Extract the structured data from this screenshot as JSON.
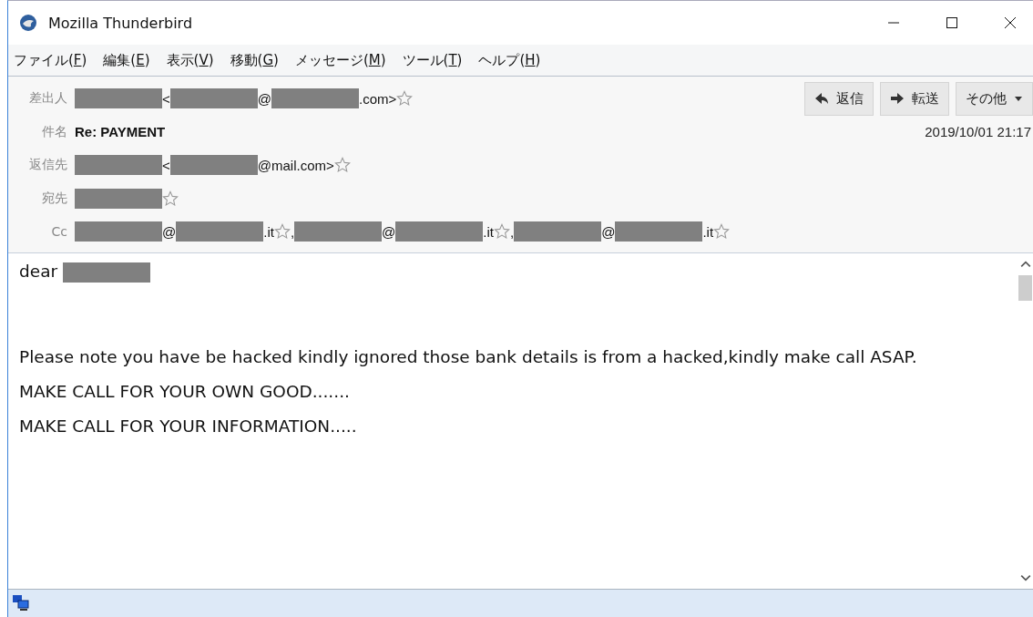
{
  "window": {
    "title": "Mozilla Thunderbird"
  },
  "menu": [
    {
      "label": "ファイル(",
      "accel": "F",
      "suffix": ")"
    },
    {
      "label": "編集(",
      "accel": "E",
      "suffix": ")"
    },
    {
      "label": "表示(",
      "accel": "V",
      "suffix": ")"
    },
    {
      "label": "移動(",
      "accel": "G",
      "suffix": ")"
    },
    {
      "label": "メッセージ(",
      "accel": "M",
      "suffix": ")"
    },
    {
      "label": "ツール(",
      "accel": "T",
      "suffix": ")"
    },
    {
      "label": "ヘルプ(",
      "accel": "H",
      "suffix": ")"
    }
  ],
  "actions": [
    {
      "kind": "reply",
      "label": "返信"
    },
    {
      "kind": "forward",
      "label": "転送"
    },
    {
      "kind": "more",
      "label": "その他"
    }
  ],
  "date": "2019/10/01 21:17",
  "headers": [
    {
      "label": "差出人",
      "parts": [
        {
          "kind": "redacted"
        },
        {
          "kind": "text",
          "text": " <"
        },
        {
          "kind": "redacted"
        },
        {
          "kind": "text",
          "text": "@"
        },
        {
          "kind": "redacted"
        },
        {
          "kind": "text",
          "text": ".com>"
        },
        {
          "kind": "star"
        }
      ]
    },
    {
      "label": "件名",
      "subject": "Re: PAYMENT"
    },
    {
      "label": "返信先",
      "parts": [
        {
          "kind": "redacted"
        },
        {
          "kind": "text",
          "text": " <"
        },
        {
          "kind": "redacted"
        },
        {
          "kind": "text",
          "text": "@mail.com>"
        },
        {
          "kind": "star"
        }
      ]
    },
    {
      "label": "宛先",
      "parts": [
        {
          "kind": "redacted"
        },
        {
          "kind": "star"
        }
      ]
    },
    {
      "label": "Cc",
      "parts": [
        {
          "kind": "redacted"
        },
        {
          "kind": "text",
          "text": "@"
        },
        {
          "kind": "redacted"
        },
        {
          "kind": "text",
          "text": ".it"
        },
        {
          "kind": "star"
        },
        {
          "kind": "text",
          "text": ", "
        },
        {
          "kind": "redacted"
        },
        {
          "kind": "text",
          "text": "@"
        },
        {
          "kind": "redacted"
        },
        {
          "kind": "text",
          "text": ".it"
        },
        {
          "kind": "star"
        },
        {
          "kind": "text",
          "text": ", "
        },
        {
          "kind": "redacted"
        },
        {
          "kind": "text",
          "text": "@"
        },
        {
          "kind": "redacted"
        },
        {
          "kind": "text",
          "text": ".it"
        },
        {
          "kind": "star"
        }
      ]
    }
  ],
  "body": [
    {
      "parts": [
        {
          "kind": "text",
          "text": "dear "
        },
        {
          "kind": "redacted"
        }
      ]
    },
    {
      "parts": [
        {
          "kind": "text",
          "text": "Please note you have be hacked kindly ignored those bank details is from a hacked,kindly make call ASAP."
        }
      ]
    },
    {
      "parts": [
        {
          "kind": "text",
          "text": "MAKE CALL FOR YOUR OWN GOOD......."
        }
      ]
    },
    {
      "parts": [
        {
          "kind": "text",
          "text": "MAKE CALL FOR YOUR INFORMATION....."
        }
      ]
    }
  ]
}
